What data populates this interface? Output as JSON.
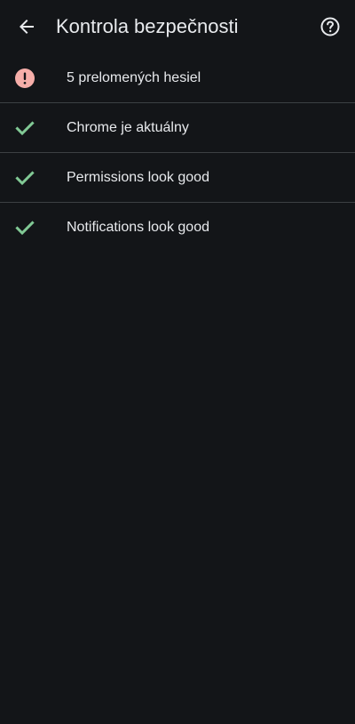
{
  "toolbar": {
    "back_icon": "arrow-back-icon",
    "title": "Kontrola bezpečnosti",
    "help_icon": "help-circle-icon"
  },
  "colors": {
    "background": "#131518",
    "text": "#e8eaed",
    "divider": "#3c4043",
    "warning": "#f6aea9",
    "success": "#81c995"
  },
  "checks": [
    {
      "label": "5 prelomených hesiel",
      "status": "warning",
      "icon": "alert-circle-icon"
    },
    {
      "label": "Chrome je aktuálny",
      "status": "ok",
      "icon": "check-icon"
    },
    {
      "label": "Permissions look good",
      "status": "ok",
      "icon": "check-icon"
    },
    {
      "label": "Notifications look good",
      "status": "ok",
      "icon": "check-icon"
    }
  ]
}
